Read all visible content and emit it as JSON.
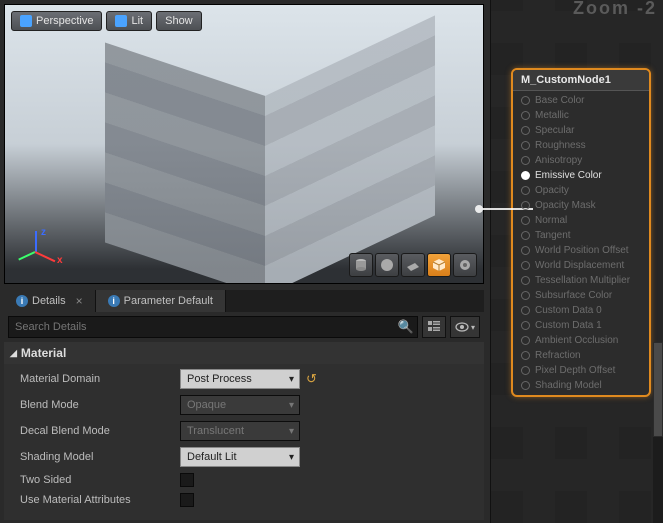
{
  "zoom_label": "Zoom -2",
  "viewport": {
    "toolbar": {
      "perspective": "Perspective",
      "lit": "Lit",
      "show": "Show"
    },
    "axes": {
      "x": "x",
      "z": "z"
    },
    "primitives": [
      "cylinder",
      "sphere",
      "plane",
      "cube",
      "custom"
    ],
    "active_primitive": "cube"
  },
  "tabs": {
    "details": "Details",
    "params": "Parameter Default"
  },
  "search": {
    "placeholder": "Search Details"
  },
  "section": {
    "title": "Material"
  },
  "props": {
    "domain": {
      "label": "Material Domain",
      "value": "Post Process",
      "reset": true
    },
    "blend": {
      "label": "Blend Mode",
      "value": "Opaque"
    },
    "decal": {
      "label": "Decal Blend Mode",
      "value": "Translucent"
    },
    "shading": {
      "label": "Shading Model",
      "value": "Default Lit"
    },
    "twosided": {
      "label": "Two Sided"
    },
    "useattr": {
      "label": "Use Material Attributes"
    }
  },
  "node": {
    "title": "M_CustomNode1",
    "pins": [
      {
        "label": "Base Color",
        "active": false
      },
      {
        "label": "Metallic",
        "active": false
      },
      {
        "label": "Specular",
        "active": false
      },
      {
        "label": "Roughness",
        "active": false
      },
      {
        "label": "Anisotropy",
        "active": false
      },
      {
        "label": "Emissive Color",
        "active": true
      },
      {
        "label": "Opacity",
        "active": false
      },
      {
        "label": "Opacity Mask",
        "active": false
      },
      {
        "label": "Normal",
        "active": false
      },
      {
        "label": "Tangent",
        "active": false
      },
      {
        "label": "World Position Offset",
        "active": false
      },
      {
        "label": "World Displacement",
        "active": false
      },
      {
        "label": "Tessellation Multiplier",
        "active": false
      },
      {
        "label": "Subsurface Color",
        "active": false
      },
      {
        "label": "Custom Data 0",
        "active": false
      },
      {
        "label": "Custom Data 1",
        "active": false
      },
      {
        "label": "Ambient Occlusion",
        "active": false
      },
      {
        "label": "Refraction",
        "active": false
      },
      {
        "label": "Pixel Depth Offset",
        "active": false
      },
      {
        "label": "Shading Model",
        "active": false
      }
    ]
  }
}
